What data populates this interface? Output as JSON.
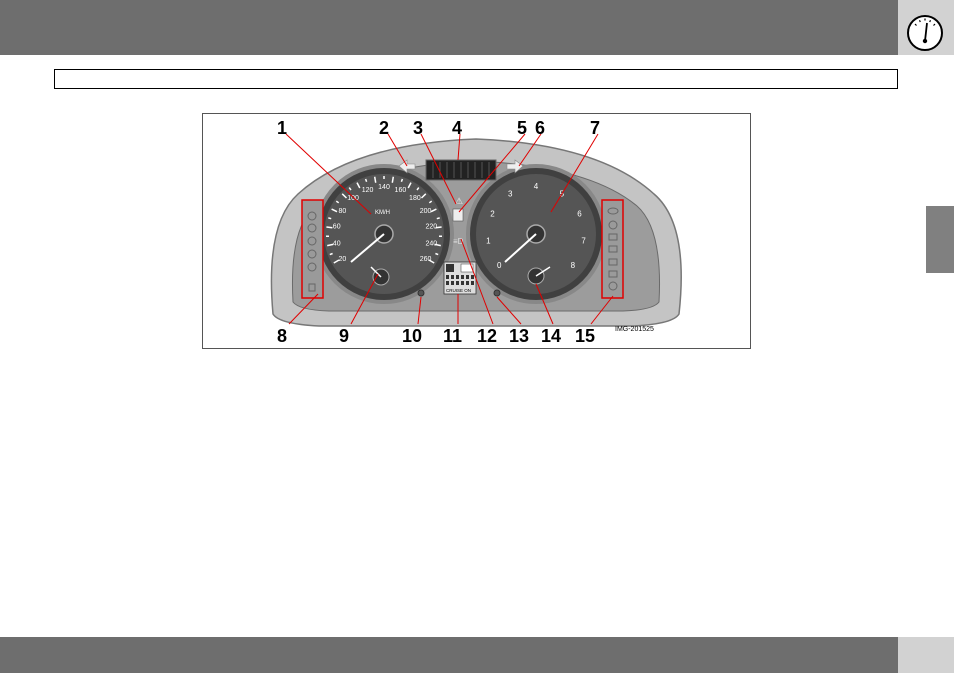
{
  "figure": {
    "image_id": "IMG-201525",
    "speedometer": {
      "unit": "KM/H",
      "scale": [
        "20",
        "40",
        "60",
        "80",
        "100",
        "120",
        "140",
        "160",
        "180",
        "200",
        "220",
        "240",
        "260"
      ]
    },
    "tachometer": {
      "scale": [
        "0",
        "1",
        "2",
        "3",
        "4",
        "5",
        "6",
        "7",
        "8"
      ]
    },
    "display_text": "CRUISE ON",
    "callouts": [
      "1",
      "2",
      "3",
      "4",
      "5",
      "6",
      "7",
      "8",
      "9",
      "10",
      "11",
      "12",
      "13",
      "14",
      "15"
    ]
  },
  "icons": {
    "header": "gauge-icon"
  },
  "colors": {
    "bars": "#6e6e6e",
    "corner": "#d2d2d2",
    "leader_lines": "#e00000"
  }
}
